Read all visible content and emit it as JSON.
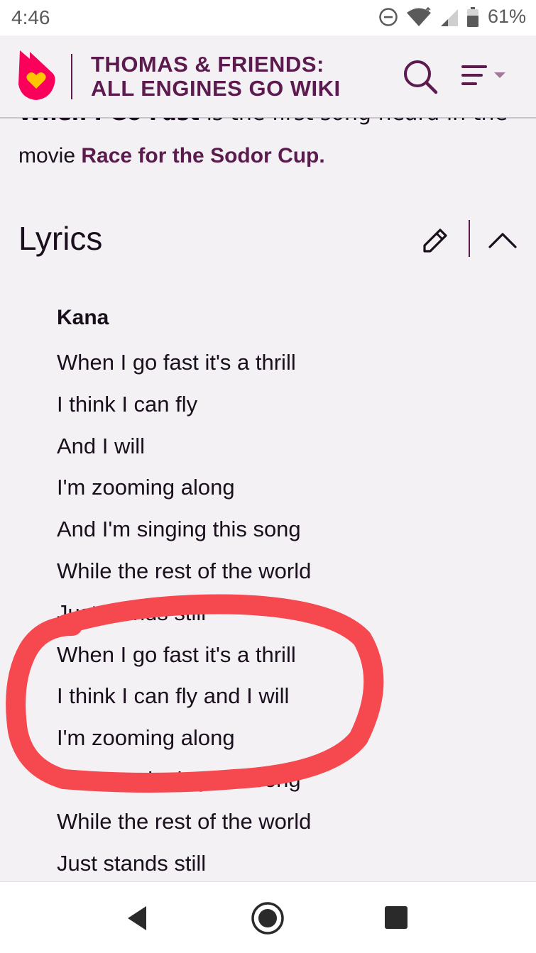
{
  "status_bar": {
    "time": "4:46",
    "battery_percent": "61%",
    "icons": [
      "do-not-disturb-icon",
      "wifi-icon",
      "cell-signal-icon",
      "battery-icon"
    ]
  },
  "header": {
    "logo": "fandom-heart-logo",
    "title_line1": "THOMAS & FRIENDS:",
    "title_line2": "ALL ENGINES GO WIKI",
    "brand_color": "#5c1b4e",
    "icons": [
      "search-icon",
      "menu-icon"
    ]
  },
  "article": {
    "intro_cut_bold": "When I Go Fast",
    "intro_cut_rest": " is the first song heard in the",
    "intro_prefix": "movie ",
    "intro_link": "Race for the Sodor Cup",
    "intro_suffix": ".",
    "section": {
      "title": "Lyrics",
      "icons": [
        "edit-pencil-icon",
        "chevron-up-icon"
      ]
    },
    "lyrics": {
      "singer": "Kana",
      "lines": [
        "When I go fast it's a thrill",
        "I think I can fly",
        "And I will",
        "I'm zooming along",
        "And I'm singing this song",
        "While the rest of the world",
        "Just stands still",
        "When I go fast it's a thrill",
        "I think I can fly and I will",
        "I'm zooming along",
        "And I'm singing this song",
        "While the rest of the world",
        "Just stands still"
      ]
    }
  },
  "annotation": {
    "color": "#f5484f",
    "shape": "hand-drawn-circle"
  },
  "nav_bar": {
    "icons": [
      "back-icon",
      "home-icon",
      "recents-icon"
    ]
  }
}
